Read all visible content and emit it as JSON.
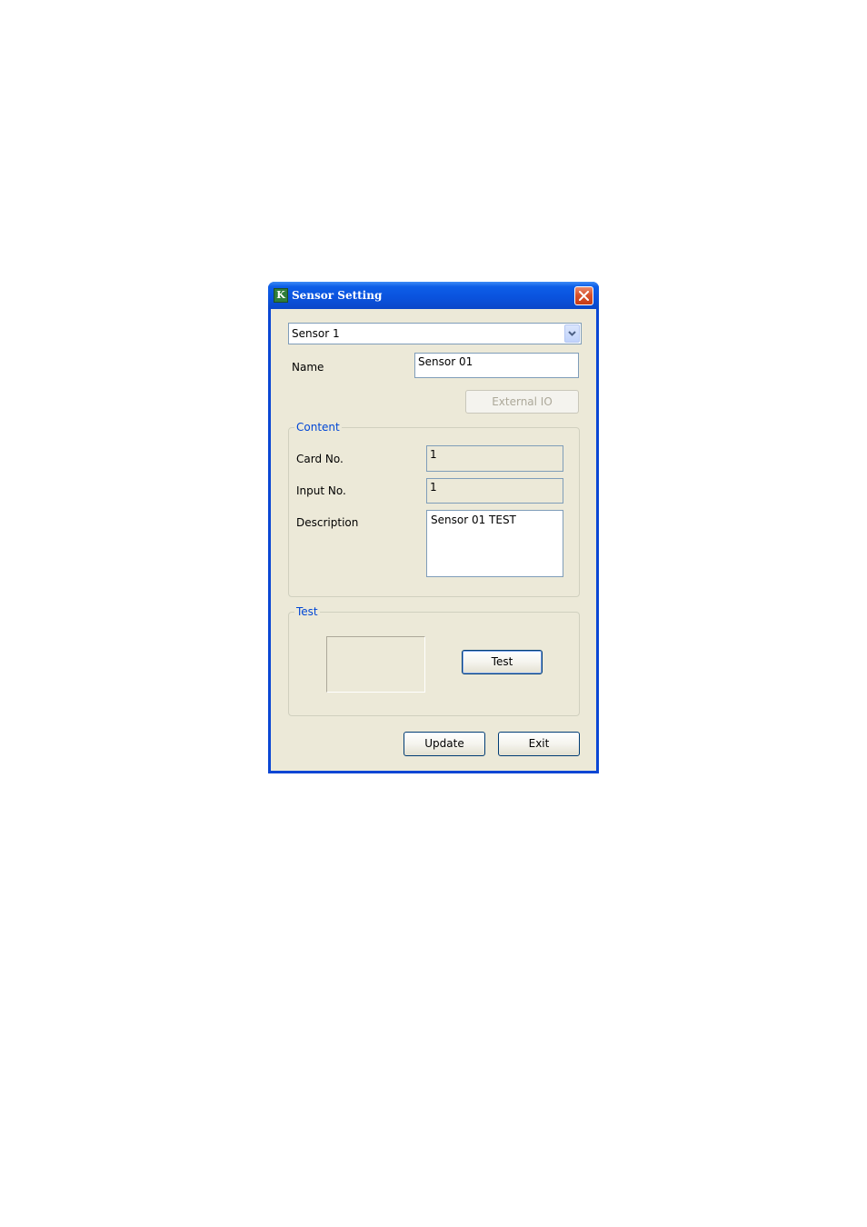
{
  "window": {
    "title": "Sensor Setting",
    "icon": "app-icon",
    "icon_glyph": "K"
  },
  "sensor_select": {
    "selected": "Sensor 1"
  },
  "name": {
    "label": "Name",
    "value": "Sensor 01"
  },
  "external_io_button": {
    "label": "External IO"
  },
  "content": {
    "title": "Content",
    "card_no_label": "Card No.",
    "card_no_value": "1",
    "input_no_label": "Input No.",
    "input_no_value": "1",
    "description_label": "Description",
    "description_value": "Sensor 01 TEST"
  },
  "test": {
    "title": "Test",
    "button_label": "Test"
  },
  "footer": {
    "update_label": "Update",
    "exit_label": "Exit"
  },
  "colors": {
    "titlebar": "#0a52dd",
    "client_bg": "#ece9d8",
    "group_title": "#0046d5",
    "close_button": "#d8522c"
  }
}
